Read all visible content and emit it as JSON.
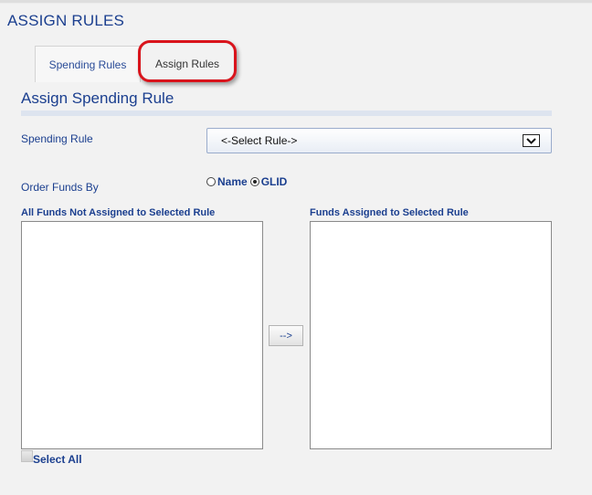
{
  "page": {
    "title": "ASSIGN RULES"
  },
  "tabs": [
    {
      "label": "Spending Rules"
    },
    {
      "label": "Assign Rules"
    }
  ],
  "section": {
    "heading": "Assign Spending Rule"
  },
  "form": {
    "spending_rule_label": "Spending Rule",
    "spending_rule_value": "<-Select Rule->",
    "order_label": "Order Funds By",
    "order_options": [
      {
        "label": "Name",
        "checked": false
      },
      {
        "label": "GLID",
        "checked": true
      }
    ]
  },
  "lists": {
    "unassigned_label": "All Funds Not Assigned to Selected Rule",
    "assigned_label": "Funds Assigned to Selected Rule",
    "move_button_label": "-->",
    "select_all_label": "Select All"
  },
  "colors": {
    "accent": "#1b3f8f",
    "highlight": "#d9141c"
  }
}
